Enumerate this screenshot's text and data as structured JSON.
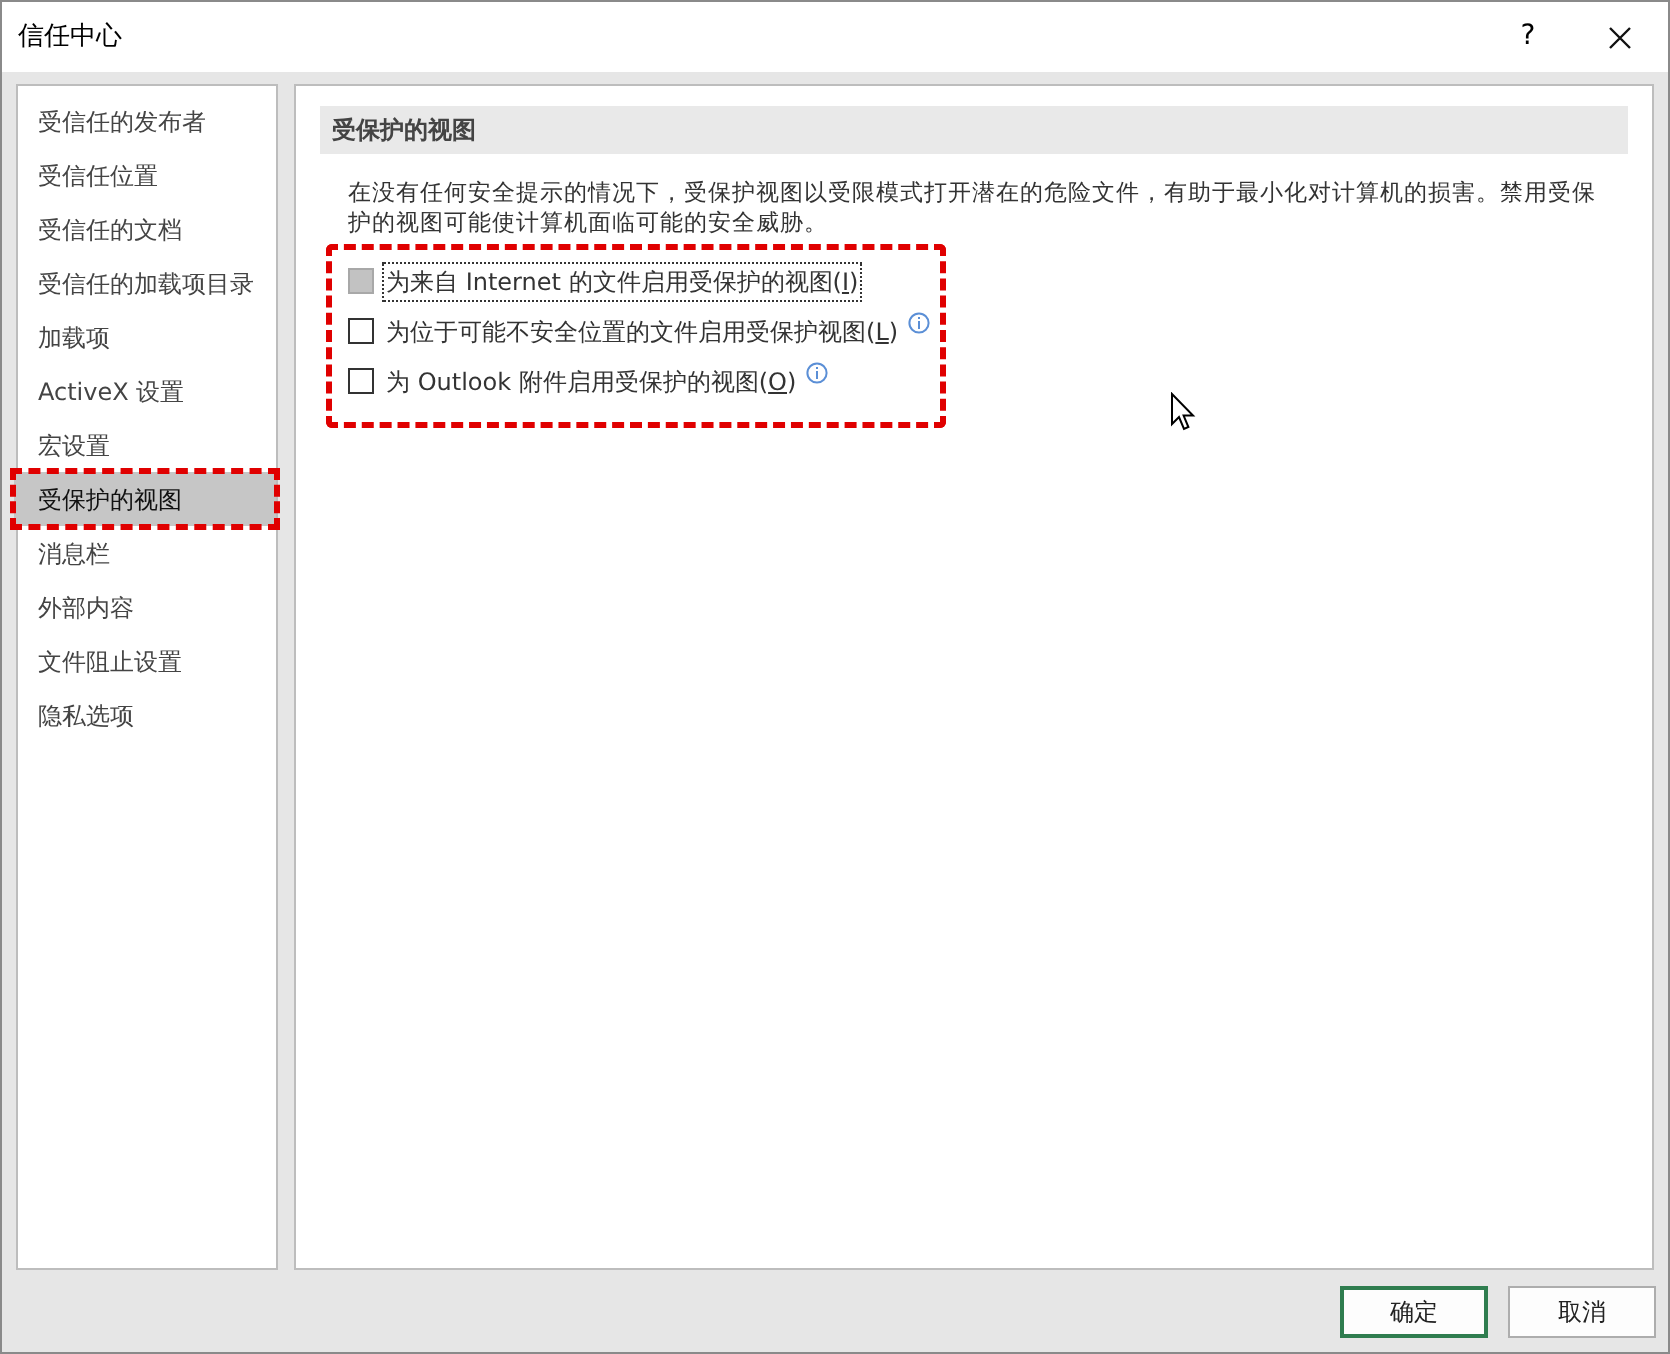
{
  "window": {
    "title": "信任中心",
    "help": "?"
  },
  "sidebar": {
    "items": [
      {
        "label": "受信任的发布者",
        "selected": false,
        "highlighted": false
      },
      {
        "label": "受信任位置",
        "selected": false,
        "highlighted": false
      },
      {
        "label": "受信任的文档",
        "selected": false,
        "highlighted": false
      },
      {
        "label": "受信任的加载项目录",
        "selected": false,
        "highlighted": false
      },
      {
        "label": "加载项",
        "selected": false,
        "highlighted": false
      },
      {
        "label": "ActiveX 设置",
        "selected": false,
        "highlighted": false
      },
      {
        "label": "宏设置",
        "selected": false,
        "highlighted": false
      },
      {
        "label": "受保护的视图",
        "selected": true,
        "highlighted": true
      },
      {
        "label": "消息栏",
        "selected": false,
        "highlighted": false
      },
      {
        "label": "外部内容",
        "selected": false,
        "highlighted": false
      },
      {
        "label": "文件阻止设置",
        "selected": false,
        "highlighted": false
      },
      {
        "label": "隐私选项",
        "selected": false,
        "highlighted": false
      }
    ]
  },
  "section": {
    "title": "受保护的视图",
    "description": "在没有任何安全提示的情况下，受保护视图以受限模式打开潜在的危险文件，有助于最小化对计算机的损害。禁用受保护的视图可能使计算机面临可能的安全威胁。",
    "highlighted": true,
    "options": [
      {
        "text_before": "为来自 Internet 的文件启用受保护的视图(",
        "access_key": "I",
        "text_after": ")",
        "checked": false,
        "disabled": true,
        "focused": true,
        "info": false
      },
      {
        "text_before": "为位于可能不安全位置的文件启用受保护视图(",
        "access_key": "L",
        "text_after": ")",
        "checked": false,
        "disabled": false,
        "focused": false,
        "info": true
      },
      {
        "text_before": "为 Outlook 附件启用受保护的视图(",
        "access_key": "O",
        "text_after": ")",
        "checked": false,
        "disabled": false,
        "focused": false,
        "info": true
      }
    ]
  },
  "buttons": [
    {
      "label": "确定",
      "default": true
    },
    {
      "label": "取消",
      "default": false
    }
  ]
}
